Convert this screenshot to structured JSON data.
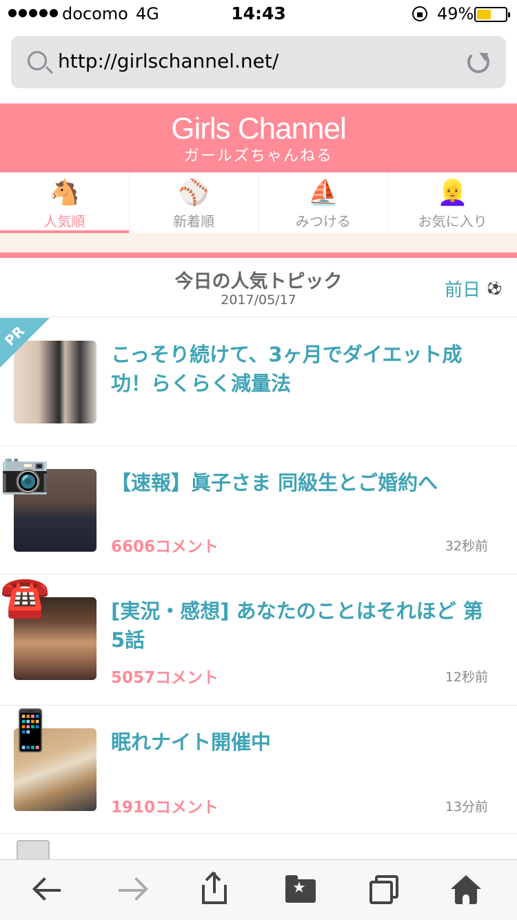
{
  "status_bar": {
    "carrier": "docomo",
    "network": "4G",
    "time": "14:43",
    "battery": "49%"
  },
  "browser": {
    "url": "http://girlschannel.net/"
  },
  "site": {
    "logo": "Girls Channel",
    "sublogo": "ガールズちゃんねる",
    "brand_color": "#ff8b97",
    "accent_color": "#3ea3b6"
  },
  "tabs": [
    {
      "emoji": "🐴",
      "label": "人気順",
      "active": true
    },
    {
      "emoji": "⚾",
      "label": "新着順",
      "active": false
    },
    {
      "emoji": "⛵",
      "label": "みつける",
      "active": false
    },
    {
      "emoji": "👱‍♀️",
      "label": "お気に入り",
      "active": false
    }
  ],
  "section": {
    "title": "今日の人気トピック",
    "date": "2017/05/17",
    "prev_label": "前日",
    "prev_emoji": "⚽"
  },
  "topics": [
    {
      "title": "こっそり続けて、3ヶ月でダイエット成功！らくらく減量法",
      "badge": "PR",
      "comments": "",
      "time": ""
    },
    {
      "title": "【速報】眞子さま 同級生とご婚約へ",
      "icon": "📷",
      "comments": "6606コメント",
      "time": "32秒前"
    },
    {
      "title": "[実況・感想] あなたのことはそれほど 第5話",
      "icon": "☎️",
      "comments": "5057コメント",
      "time": "12秒前"
    },
    {
      "title": "眠れナイト開催中",
      "icon": "📱",
      "comments": "1910コメント",
      "time": "13分前"
    }
  ],
  "toolbar": {
    "icons": [
      "back-icon",
      "forward-icon",
      "share-icon",
      "bookmarks-icon",
      "tabs-icon",
      "home-icon"
    ]
  }
}
